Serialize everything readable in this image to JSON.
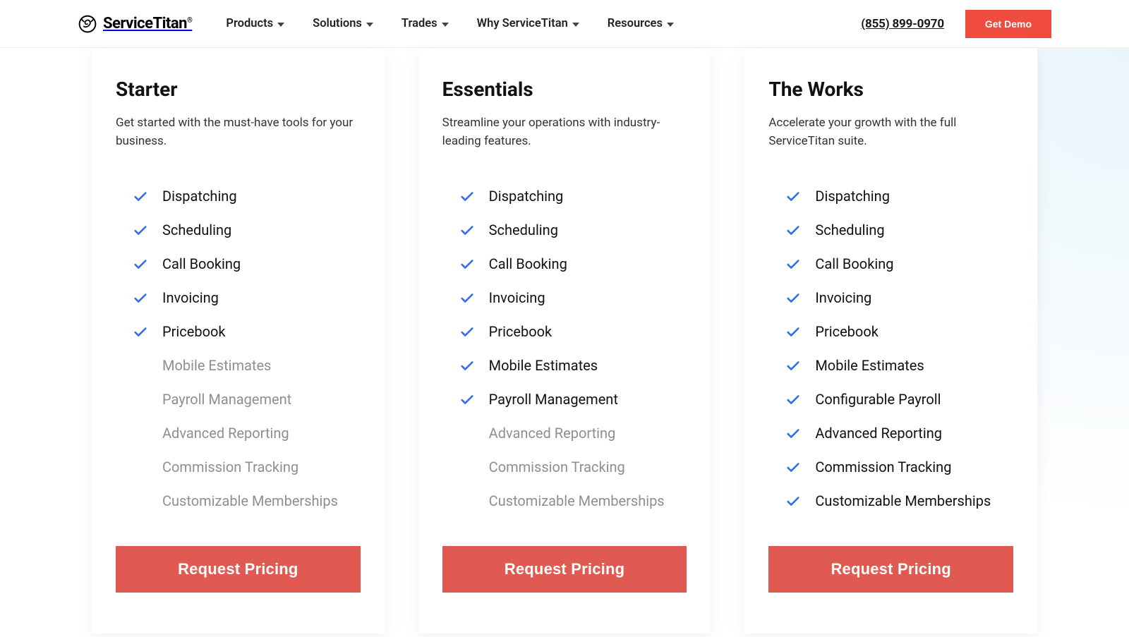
{
  "header": {
    "brand": "ServiceTitan",
    "nav": {
      "products": "Products",
      "solutions": "Solutions",
      "trades": "Trades",
      "why": "Why ServiceTitan",
      "resources": "Resources"
    },
    "phone": "(855) 899-0970",
    "demo": "Get Demo"
  },
  "plans": [
    {
      "title": "Starter",
      "desc": "Get started with the must-have tools for your business.",
      "cta": "Request Pricing",
      "features": [
        {
          "label": "Dispatching",
          "included": true
        },
        {
          "label": "Scheduling",
          "included": true
        },
        {
          "label": "Call Booking",
          "included": true
        },
        {
          "label": "Invoicing",
          "included": true
        },
        {
          "label": "Pricebook",
          "included": true
        },
        {
          "label": "Mobile Estimates",
          "included": false
        },
        {
          "label": "Payroll Management",
          "included": false
        },
        {
          "label": "Advanced Reporting",
          "included": false
        },
        {
          "label": "Commission Tracking",
          "included": false
        },
        {
          "label": "Customizable Memberships",
          "included": false
        }
      ]
    },
    {
      "title": "Essentials",
      "desc": "Streamline your operations with industry-leading features.",
      "cta": "Request Pricing",
      "features": [
        {
          "label": "Dispatching",
          "included": true
        },
        {
          "label": "Scheduling",
          "included": true
        },
        {
          "label": "Call Booking",
          "included": true
        },
        {
          "label": "Invoicing",
          "included": true
        },
        {
          "label": "Pricebook",
          "included": true
        },
        {
          "label": "Mobile Estimates",
          "included": true
        },
        {
          "label": "Payroll Management",
          "included": true
        },
        {
          "label": "Advanced Reporting",
          "included": false
        },
        {
          "label": "Commission Tracking",
          "included": false
        },
        {
          "label": "Customizable Memberships",
          "included": false
        }
      ]
    },
    {
      "title": "The Works",
      "desc": "Accelerate your growth with the full ServiceTitan suite.",
      "cta": "Request Pricing",
      "features": [
        {
          "label": "Dispatching",
          "included": true
        },
        {
          "label": "Scheduling",
          "included": true
        },
        {
          "label": "Call Booking",
          "included": true
        },
        {
          "label": "Invoicing",
          "included": true
        },
        {
          "label": "Pricebook",
          "included": true
        },
        {
          "label": "Mobile Estimates",
          "included": true
        },
        {
          "label": "Configurable Payroll",
          "included": true
        },
        {
          "label": "Advanced Reporting",
          "included": true
        },
        {
          "label": "Commission Tracking",
          "included": true
        },
        {
          "label": "Customizable Memberships",
          "included": true
        }
      ]
    }
  ]
}
